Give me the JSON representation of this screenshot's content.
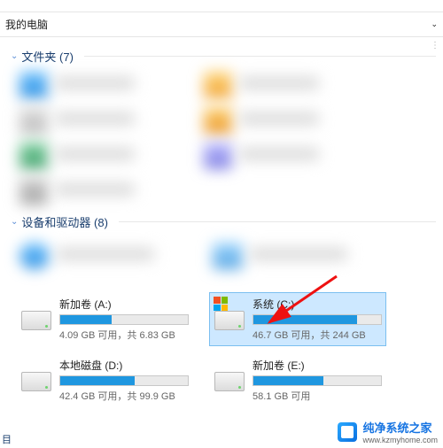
{
  "addressbar": {
    "location": "我的电脑"
  },
  "groups": {
    "folders": {
      "title": "文件夹",
      "count": "(7)"
    },
    "drives": {
      "title": "设备和驱动器",
      "count": "(8)"
    }
  },
  "drives": [
    {
      "name": "新加卷 (A:)",
      "info": "4.09 GB 可用，共 6.83 GB",
      "fill_pct": 40,
      "has_winlogo": false,
      "selected": false
    },
    {
      "name": "系统 (C:)",
      "info": "46.7 GB 可用，共 244 GB",
      "fill_pct": 81,
      "has_winlogo": true,
      "selected": true
    },
    {
      "name": "本地磁盘 (D:)",
      "info": "42.4 GB 可用，共 99.9 GB",
      "fill_pct": 58,
      "has_winlogo": false,
      "selected": false
    },
    {
      "name": "新加卷 (E:)",
      "info": "58.1 GB 可用",
      "fill_pct": 55,
      "has_winlogo": false,
      "selected": false
    }
  ],
  "watermark": {
    "text": "纯净系统之家",
    "url": "www.kzmyhome.com"
  },
  "corner_label": "目"
}
